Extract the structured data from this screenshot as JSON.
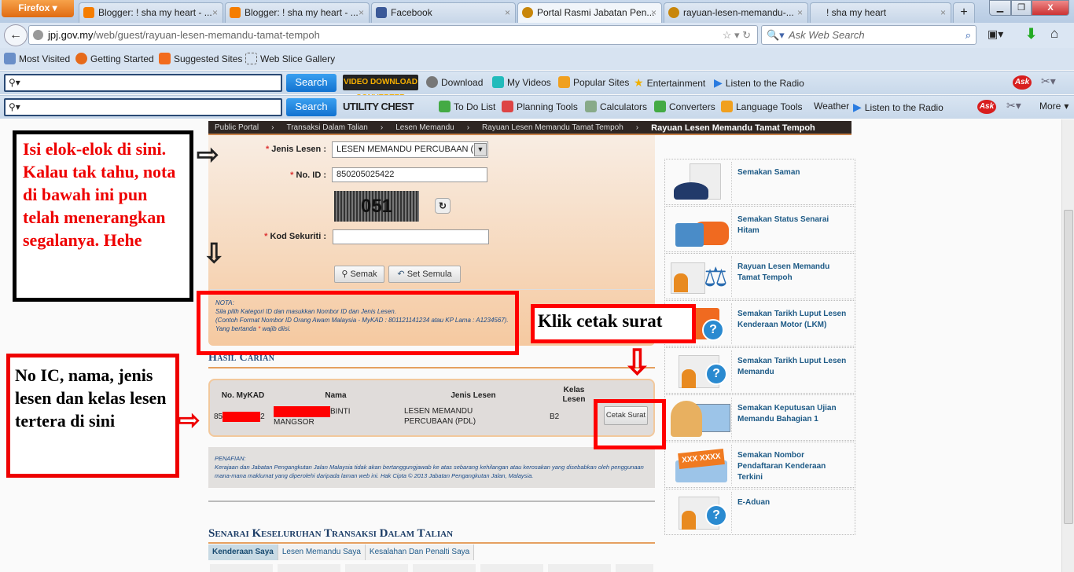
{
  "browser": {
    "menu_button": "Firefox",
    "tabs": [
      {
        "title": "Blogger: ! sha my heart - ...",
        "icon": "blogger-icon",
        "color": "#f57d00"
      },
      {
        "title": "Blogger: ! sha my heart - ...",
        "icon": "blogger-icon",
        "color": "#f57d00"
      },
      {
        "title": "Facebook",
        "icon": "facebook-icon",
        "color": "#3b5998"
      },
      {
        "title": "Portal Rasmi Jabatan Pen...",
        "icon": "jpj-crest-icon",
        "color": "#c8860a",
        "active": true
      },
      {
        "title": "rayuan-lesen-memandu-...",
        "icon": "jpj-crest-icon",
        "color": "#c8860a"
      },
      {
        "title": "! sha my heart",
        "icon": "",
        "color": ""
      }
    ],
    "url_domain": "jpj.gov.my",
    "url_path": "/web/guest/rayuan-lesen-memandu-tamat-tempoh",
    "search_placeholder": "Ask Web Search",
    "bookmarks": [
      "Most Visited",
      "Getting Started",
      "Suggested Sites",
      "Web Slice Gallery"
    ],
    "toolbar1": {
      "search_button": "Search",
      "logo": "VIDEO DOWNLOAD CONVERTER",
      "items": [
        "Download",
        "My Videos",
        "Popular Sites",
        "Entertainment",
        "Listen to the Radio"
      ],
      "ask": "Ask"
    },
    "toolbar2": {
      "search_button": "Search",
      "logo": "UTILITY CHEST",
      "items": [
        "To Do List",
        "Planning Tools",
        "Calculators",
        "Converters",
        "Language Tools",
        "Weather",
        "Listen to the Radio"
      ],
      "ask": "Ask",
      "more": "More"
    }
  },
  "breadcrumb": [
    "Public Portal",
    "Transaksi Dalam Talian",
    "Lesen Memandu",
    "Rayuan Lesen Memandu Tamat Tempoh",
    "Rayuan Lesen Memandu Tamat Tempoh"
  ],
  "form": {
    "jenis_lesen_label": "Jenis Lesen :",
    "jenis_lesen_value": "LESEN MEMANDU PERCUBAAN (PDL)",
    "no_id_label": "No. ID :",
    "no_id_value": "850205025422",
    "captcha_text": "051",
    "kod_label": "Kod Sekuriti :",
    "kod_value": "",
    "semak": "Semak",
    "set_semula": "Set Semula",
    "required_mark": "*"
  },
  "nota": {
    "title": "NOTA:",
    "line1": "Sila pilih Kategori ID dan masukkan Nombor ID dan Jenis Lesen.",
    "line2": "(Contoh Format Nombor ID Orang Awam Malaysia - MyKAD : 801121141234 atau KP Lama : A1234567).",
    "line3_pre": "Yang bertanda ",
    "line3_star": "*",
    "line3_post": " wajib diisi."
  },
  "hasil": {
    "title": "Hasil Carian",
    "headers": [
      "No. MyKAD",
      "Nama",
      "Jenis Lesen",
      "Kelas Lesen"
    ],
    "row": {
      "mykad_prefix": "85",
      "mykad_suffix": "2",
      "nama_visible": "BINTI",
      "nama_line2": "MANGSOR",
      "jenis": "LESEN MEMANDU PERCUBAAN (PDL)",
      "kelas": "B2",
      "action": "Cetak Surat"
    }
  },
  "penafian": {
    "title": "PENAFIAN:",
    "text": "Kerajaan dan Jabatan Pengangkutan Jalan Malaysia tidak akan bertanggungjawab ke atas sebarang kehilangan atau kerosakan yang disebabkan oleh penggunaan mana-mana maklumat yang diperolehi daripada laman web ini. Hak Cipta © 2013 Jabatan Pengangkutan Jalan, Malaysia."
  },
  "senarai": {
    "title": "Senarai Keseluruhan Transaksi Dalam Talian",
    "tabs": [
      "Kenderaan Saya",
      "Lesen Memandu Saya",
      "Kesalahan Dan Penalti Saya"
    ]
  },
  "sidebar": [
    {
      "label": "Semakan Saman",
      "icon": "police-cap-document-icon"
    },
    {
      "label": "Semakan Status Senarai Hitam",
      "icon": "lock-car-icon"
    },
    {
      "label": "Rayuan Lesen Memandu Tamat Tempoh",
      "icon": "id-card-scales-icon"
    },
    {
      "label": "Semakan Tarikh Luput Lesen Kenderaan Motor (LKM)",
      "icon": "road-tax-question-icon"
    },
    {
      "label": "Semakan Tarikh Luput Lesen Memandu",
      "icon": "id-card-question-icon"
    },
    {
      "label": "Semakan Keputusan Ujian Memandu Bahagian 1",
      "icon": "person-certificate-icon"
    },
    {
      "label": "Semakan Nombor Pendaftaran Kenderaan Terkini",
      "icon": "plate-folder-icon",
      "plate": "XXX XXXX"
    },
    {
      "label": "E-Aduan",
      "icon": "id-card-question-icon"
    }
  ],
  "annotations": {
    "fill_note": "Isi elok-elok di sini. Kalau tak tahu, nota di bawah ini pun telah menerangkan segalanya. Hehe",
    "result_note": "No IC, nama, jenis lesen dan kelas lesen tertera di sini",
    "print_note": "Klik cetak surat",
    "color_red": "#ff0000",
    "color_black": "#000000"
  }
}
